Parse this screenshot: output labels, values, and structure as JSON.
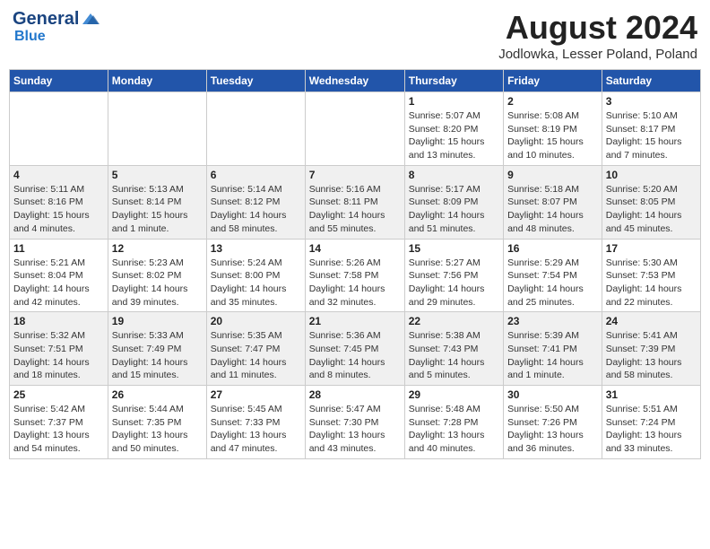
{
  "header": {
    "logo_line1": "General",
    "logo_line2": "Blue",
    "title": "August 2024",
    "location": "Jodlowka, Lesser Poland, Poland"
  },
  "weekdays": [
    "Sunday",
    "Monday",
    "Tuesday",
    "Wednesday",
    "Thursday",
    "Friday",
    "Saturday"
  ],
  "weeks": [
    [
      {
        "day": "",
        "info": ""
      },
      {
        "day": "",
        "info": ""
      },
      {
        "day": "",
        "info": ""
      },
      {
        "day": "",
        "info": ""
      },
      {
        "day": "1",
        "info": "Sunrise: 5:07 AM\nSunset: 8:20 PM\nDaylight: 15 hours\nand 13 minutes."
      },
      {
        "day": "2",
        "info": "Sunrise: 5:08 AM\nSunset: 8:19 PM\nDaylight: 15 hours\nand 10 minutes."
      },
      {
        "day": "3",
        "info": "Sunrise: 5:10 AM\nSunset: 8:17 PM\nDaylight: 15 hours\nand 7 minutes."
      }
    ],
    [
      {
        "day": "4",
        "info": "Sunrise: 5:11 AM\nSunset: 8:16 PM\nDaylight: 15 hours\nand 4 minutes."
      },
      {
        "day": "5",
        "info": "Sunrise: 5:13 AM\nSunset: 8:14 PM\nDaylight: 15 hours\nand 1 minute."
      },
      {
        "day": "6",
        "info": "Sunrise: 5:14 AM\nSunset: 8:12 PM\nDaylight: 14 hours\nand 58 minutes."
      },
      {
        "day": "7",
        "info": "Sunrise: 5:16 AM\nSunset: 8:11 PM\nDaylight: 14 hours\nand 55 minutes."
      },
      {
        "day": "8",
        "info": "Sunrise: 5:17 AM\nSunset: 8:09 PM\nDaylight: 14 hours\nand 51 minutes."
      },
      {
        "day": "9",
        "info": "Sunrise: 5:18 AM\nSunset: 8:07 PM\nDaylight: 14 hours\nand 48 minutes."
      },
      {
        "day": "10",
        "info": "Sunrise: 5:20 AM\nSunset: 8:05 PM\nDaylight: 14 hours\nand 45 minutes."
      }
    ],
    [
      {
        "day": "11",
        "info": "Sunrise: 5:21 AM\nSunset: 8:04 PM\nDaylight: 14 hours\nand 42 minutes."
      },
      {
        "day": "12",
        "info": "Sunrise: 5:23 AM\nSunset: 8:02 PM\nDaylight: 14 hours\nand 39 minutes."
      },
      {
        "day": "13",
        "info": "Sunrise: 5:24 AM\nSunset: 8:00 PM\nDaylight: 14 hours\nand 35 minutes."
      },
      {
        "day": "14",
        "info": "Sunrise: 5:26 AM\nSunset: 7:58 PM\nDaylight: 14 hours\nand 32 minutes."
      },
      {
        "day": "15",
        "info": "Sunrise: 5:27 AM\nSunset: 7:56 PM\nDaylight: 14 hours\nand 29 minutes."
      },
      {
        "day": "16",
        "info": "Sunrise: 5:29 AM\nSunset: 7:54 PM\nDaylight: 14 hours\nand 25 minutes."
      },
      {
        "day": "17",
        "info": "Sunrise: 5:30 AM\nSunset: 7:53 PM\nDaylight: 14 hours\nand 22 minutes."
      }
    ],
    [
      {
        "day": "18",
        "info": "Sunrise: 5:32 AM\nSunset: 7:51 PM\nDaylight: 14 hours\nand 18 minutes."
      },
      {
        "day": "19",
        "info": "Sunrise: 5:33 AM\nSunset: 7:49 PM\nDaylight: 14 hours\nand 15 minutes."
      },
      {
        "day": "20",
        "info": "Sunrise: 5:35 AM\nSunset: 7:47 PM\nDaylight: 14 hours\nand 11 minutes."
      },
      {
        "day": "21",
        "info": "Sunrise: 5:36 AM\nSunset: 7:45 PM\nDaylight: 14 hours\nand 8 minutes."
      },
      {
        "day": "22",
        "info": "Sunrise: 5:38 AM\nSunset: 7:43 PM\nDaylight: 14 hours\nand 5 minutes."
      },
      {
        "day": "23",
        "info": "Sunrise: 5:39 AM\nSunset: 7:41 PM\nDaylight: 14 hours\nand 1 minute."
      },
      {
        "day": "24",
        "info": "Sunrise: 5:41 AM\nSunset: 7:39 PM\nDaylight: 13 hours\nand 58 minutes."
      }
    ],
    [
      {
        "day": "25",
        "info": "Sunrise: 5:42 AM\nSunset: 7:37 PM\nDaylight: 13 hours\nand 54 minutes."
      },
      {
        "day": "26",
        "info": "Sunrise: 5:44 AM\nSunset: 7:35 PM\nDaylight: 13 hours\nand 50 minutes."
      },
      {
        "day": "27",
        "info": "Sunrise: 5:45 AM\nSunset: 7:33 PM\nDaylight: 13 hours\nand 47 minutes."
      },
      {
        "day": "28",
        "info": "Sunrise: 5:47 AM\nSunset: 7:30 PM\nDaylight: 13 hours\nand 43 minutes."
      },
      {
        "day": "29",
        "info": "Sunrise: 5:48 AM\nSunset: 7:28 PM\nDaylight: 13 hours\nand 40 minutes."
      },
      {
        "day": "30",
        "info": "Sunrise: 5:50 AM\nSunset: 7:26 PM\nDaylight: 13 hours\nand 36 minutes."
      },
      {
        "day": "31",
        "info": "Sunrise: 5:51 AM\nSunset: 7:24 PM\nDaylight: 13 hours\nand 33 minutes."
      }
    ]
  ]
}
